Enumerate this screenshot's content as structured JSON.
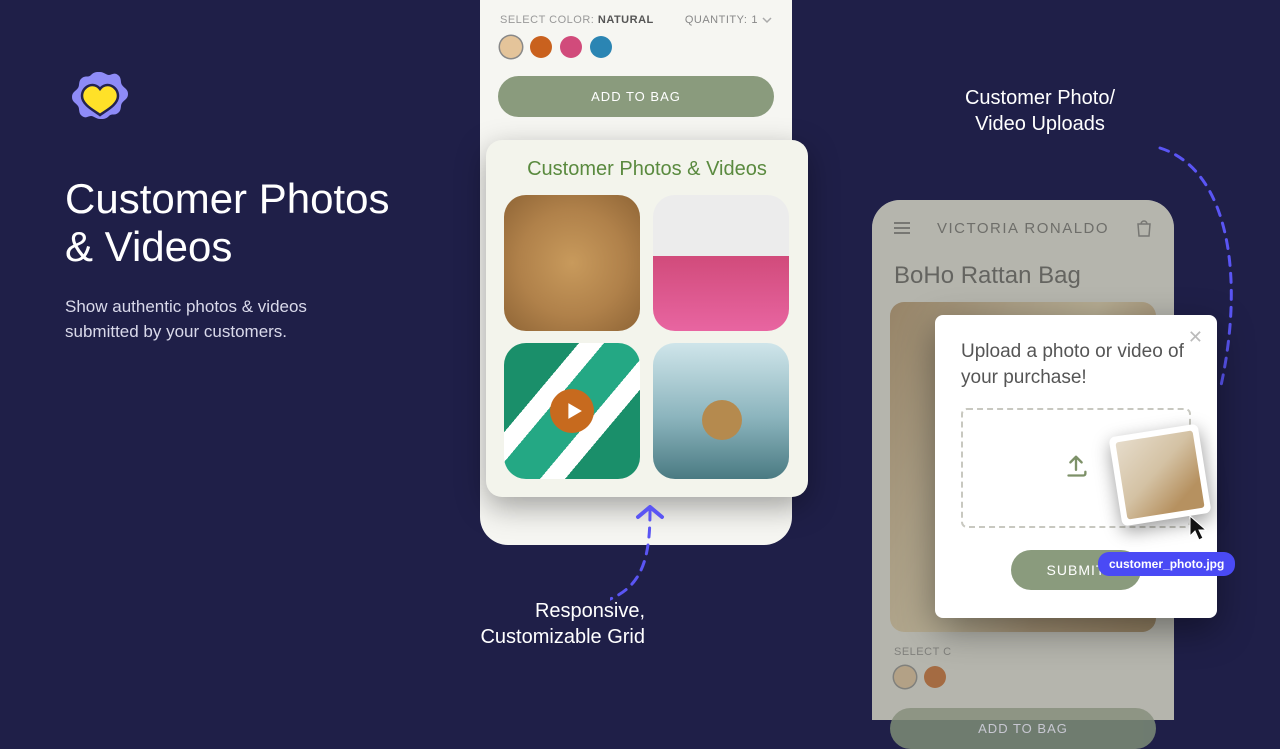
{
  "hero": {
    "title_line1": "Customer Photos",
    "title_line2": "& Videos",
    "subtitle": "Show authentic photos & videos submitted by your customers."
  },
  "phone_left": {
    "select_label": "SELECT COLOR:",
    "selected_color": "NATURAL",
    "quantity_label": "QUANTITY:",
    "quantity_value": "1",
    "swatches": [
      "#e4c49a",
      "#c9611e",
      "#d14b7b",
      "#2b85b3"
    ],
    "add_to_bag": "ADD TO BAG"
  },
  "widget": {
    "title": "Customer Photos & Videos"
  },
  "caption_left": {
    "line1": "Responsive,",
    "line2": "Customizable Grid"
  },
  "caption_right": {
    "line1": "Customer Photo/",
    "line2": "Video Uploads"
  },
  "phone_right": {
    "brand": "VICTORIA RONALDO",
    "product_title": "BoHo Rattan Bag",
    "select_label": "SELECT C",
    "swatches": [
      "#e4c49a",
      "#c9611e"
    ],
    "add_to_bag": "ADD TO BAG"
  },
  "modal": {
    "heading": "Upload a photo or video of your purchase!",
    "submit": "SUBMIT"
  },
  "drag": {
    "filename": "customer_photo.jpg"
  }
}
